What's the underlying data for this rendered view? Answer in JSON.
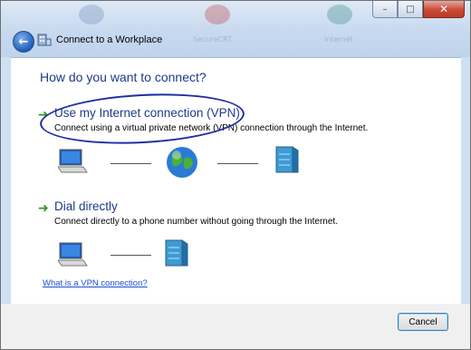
{
  "window": {
    "title": "Connect to a Workplace",
    "controls": {
      "minimize": "–",
      "maximize": "□",
      "close": "✕"
    }
  },
  "background_apps": [
    "SecureCRT",
    "Internet"
  ],
  "main": {
    "heading": "How do you want to connect?",
    "options": [
      {
        "title": "Use my Internet connection (VPN)",
        "description": "Connect using a virtual private network (VPN) connection through the Internet.",
        "arrow_icon": "green-arrow-icon",
        "diagram": [
          "computer-icon",
          "globe-icon",
          "server-icon"
        ]
      },
      {
        "title": "Dial directly",
        "description": "Connect directly to a phone number without going through the Internet.",
        "arrow_icon": "green-arrow-icon",
        "diagram": [
          "computer-icon",
          "server-icon"
        ]
      }
    ],
    "help_link": "What is a VPN connection?"
  },
  "footer": {
    "cancel_label": "Cancel"
  },
  "colors": {
    "heading": "#1e3a8a",
    "link": "#1d4fcf",
    "ink_circle": "#1f2fa3",
    "arrow": "#2e9a1f"
  }
}
